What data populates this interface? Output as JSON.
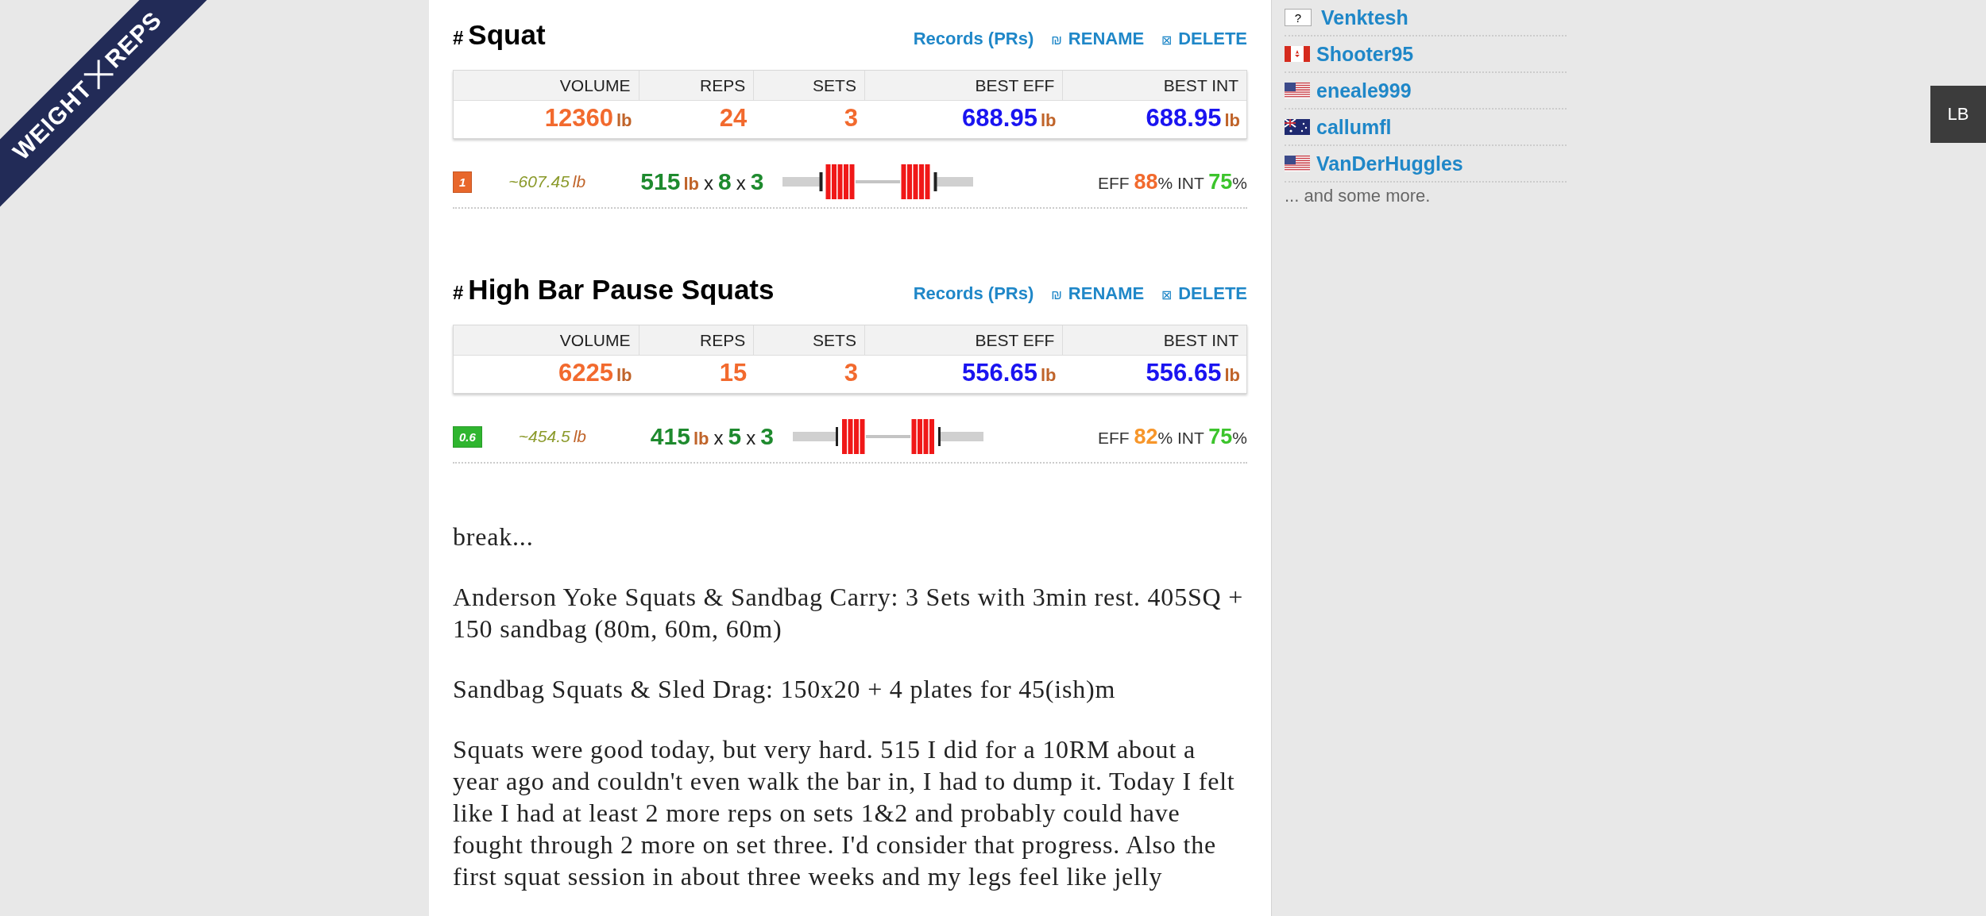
{
  "logo": {
    "words": [
      "WEIGHT",
      "REPS"
    ]
  },
  "exercises": [
    {
      "hash": "#",
      "title": "Squat",
      "links": [
        {
          "label": "Records (PRs)"
        },
        {
          "icon": "₪",
          "label": "RENAME"
        },
        {
          "icon": "⊠",
          "label": "DELETE"
        }
      ],
      "columns": [
        "VOLUME",
        "REPS",
        "SETS",
        "BEST EFF",
        "BEST INT"
      ],
      "stats": [
        {
          "value": "12360",
          "unit": "lb",
          "color": "#f26a2e"
        },
        {
          "value": "24",
          "color": "#f26a2e"
        },
        {
          "value": "3",
          "color": "#f26a2e"
        },
        {
          "value": "688.95",
          "unit": "lb",
          "color": "#1a14f0"
        },
        {
          "value": "688.95",
          "unit": "lb",
          "color": "#1a14f0"
        }
      ],
      "sets": [
        {
          "badge": "1",
          "color": "#e8672b",
          "estimate": "~607.45",
          "estimate_unit": "lb",
          "weight": "515",
          "unit": "lb",
          "times1": "x",
          "reps": "8",
          "times2": "x",
          "count": "3",
          "scores": [
            {
              "label": "EFF",
              "value": "88",
              "color": "#f26a2e",
              "pct": "%"
            },
            {
              "label": "INT",
              "value": "75",
              "color": "#3cc42c",
              "pct": "%"
            }
          ]
        }
      ]
    },
    {
      "hash": "#",
      "title": "High Bar Pause Squats",
      "links": [
        {
          "label": "Records (PRs)"
        },
        {
          "icon": "₪",
          "label": "RENAME"
        },
        {
          "icon": "⊠",
          "label": "DELETE"
        }
      ],
      "columns": [
        "VOLUME",
        "REPS",
        "SETS",
        "BEST EFF",
        "BEST INT"
      ],
      "stats": [
        {
          "value": "6225",
          "unit": "lb",
          "color": "#f26a2e"
        },
        {
          "value": "15",
          "color": "#f26a2e"
        },
        {
          "value": "3",
          "color": "#f26a2e"
        },
        {
          "value": "556.65",
          "unit": "lb",
          "color": "#1a14f0"
        },
        {
          "value": "556.65",
          "unit": "lb",
          "color": "#1a14f0"
        }
      ],
      "sets": [
        {
          "badge": "0.6",
          "color": "#2fb52f",
          "estimate": "~454.5",
          "estimate_unit": "lb",
          "weight": "415",
          "unit": "lb",
          "times1": "x",
          "reps": "5",
          "times2": "x",
          "count": "3",
          "scores": [
            {
              "label": "EFF",
              "value": "82",
              "color": "#f7962a",
              "pct": "%"
            },
            {
              "label": "INT",
              "value": "75",
              "color": "#3cc42c",
              "pct": "%"
            }
          ]
        }
      ]
    }
  ],
  "notes": [
    "break...",
    "Anderson Yoke Squats & Sandbag Carry: 3 Sets with 3min rest. 405SQ + 150 sandbag (80m, 60m, 60m)",
    "Sandbag Squats & Sled Drag: 150x20 + 4 plates for 45(ish)m",
    "Squats were good today, but very hard. 515 I did for a 10RM about a year ago and couldn't even walk the bar in, I had to dump it. Today I felt like I had at least 2 more reps on sets 1&2 and probably could have fought through 2 more on set three. I'd consider that progress. Also the first squat session in about three weeks and my legs feel like jelly"
  ],
  "people": [
    {
      "kind": "unknown",
      "flag_text": "?",
      "name": "Venktesh"
    },
    {
      "kind": "ca",
      "name": "Shooter95"
    },
    {
      "kind": "us",
      "name": "eneale999"
    },
    {
      "kind": "au",
      "name": "callumfl"
    },
    {
      "kind": "us",
      "name": "VanDerHuggles"
    }
  ],
  "more": "... and some more.",
  "side_button": "LB"
}
